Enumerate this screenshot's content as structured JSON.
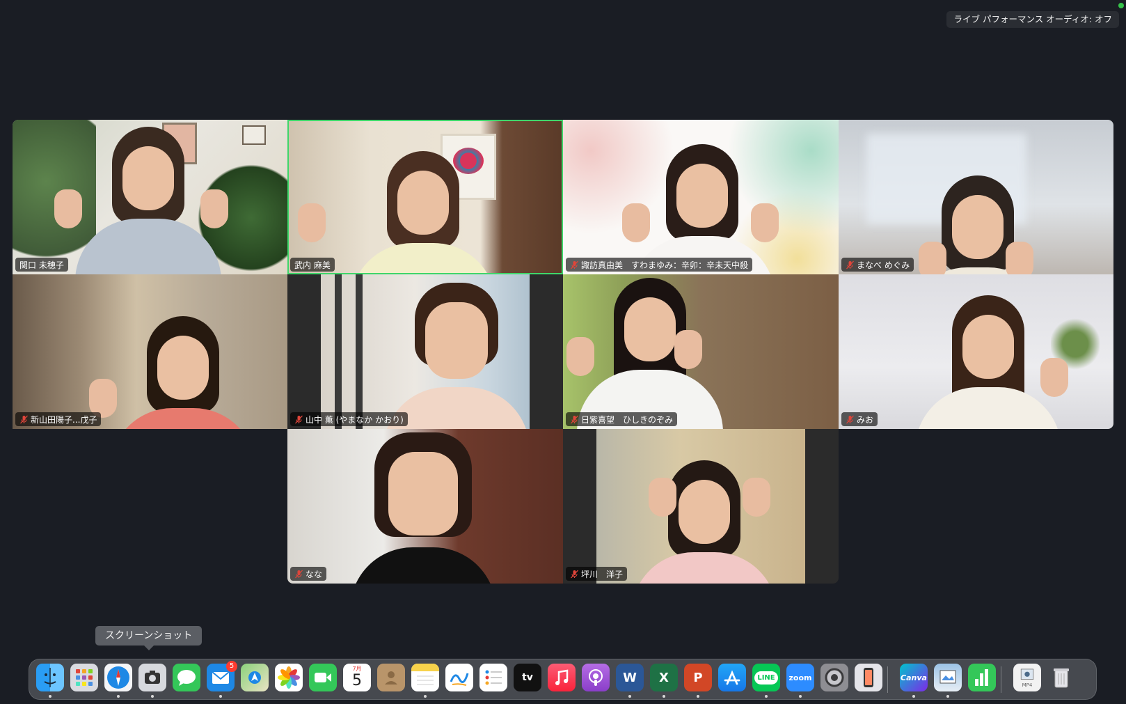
{
  "status": {
    "audio_notice": "ライブ パフォーマンス オーディオ: オフ"
  },
  "participants": [
    {
      "name": "関口 未穂子",
      "muted": false,
      "active": false
    },
    {
      "name": "武内 麻美",
      "muted": false,
      "active": true
    },
    {
      "name": "諏訪真由美　すわまゆみ：辛卯：辛未天中殺",
      "muted": true,
      "active": false
    },
    {
      "name": "まなべ めぐみ",
      "muted": true,
      "active": false
    },
    {
      "name": "新山田陽子...戊子",
      "muted": true,
      "active": false
    },
    {
      "name": "山中 薫 (やまなか かおり)",
      "muted": true,
      "active": false
    },
    {
      "name": "日紫喜望　ひしきのぞみ",
      "muted": true,
      "active": false
    },
    {
      "name": "みお",
      "muted": true,
      "active": false
    },
    {
      "name": "なな",
      "muted": true,
      "active": false
    },
    {
      "name": "坪川　洋子",
      "muted": true,
      "active": false
    }
  ],
  "tooltip": {
    "label": "スクリーンショット"
  },
  "dock": {
    "calendar_month": "7月",
    "calendar_day": "5",
    "mail_badge": "5",
    "tv_label": "tv",
    "word_label": "W",
    "excel_label": "X",
    "powerpoint_label": "P",
    "line_label": "LINE",
    "zoom_label": "zoom",
    "canva_label": "Canva",
    "file_label": "MP4",
    "icons": [
      "finder-icon",
      "launchpad-icon",
      "safari-icon",
      "screenshot-icon",
      "messages-icon",
      "mail-icon",
      "maps-icon",
      "photos-icon",
      "facetime-icon",
      "calendar-icon",
      "contacts-icon",
      "notes-icon",
      "freeform-icon",
      "reminders-icon",
      "apple-tv-icon",
      "music-icon",
      "podcasts-icon",
      "word-icon",
      "excel-icon",
      "powerpoint-icon",
      "app-store-icon",
      "line-icon",
      "zoom-icon",
      "system-settings-icon",
      "iphone-mirroring-icon",
      "canva-icon",
      "preview-icon",
      "numbers-icon",
      "mp4-file-icon",
      "trash-icon"
    ]
  },
  "colors": {
    "background": "#1a1d24",
    "active_speaker": "#3fd66a",
    "muted_mic": "#e0453a",
    "mail_badge": "#ff3b30"
  }
}
